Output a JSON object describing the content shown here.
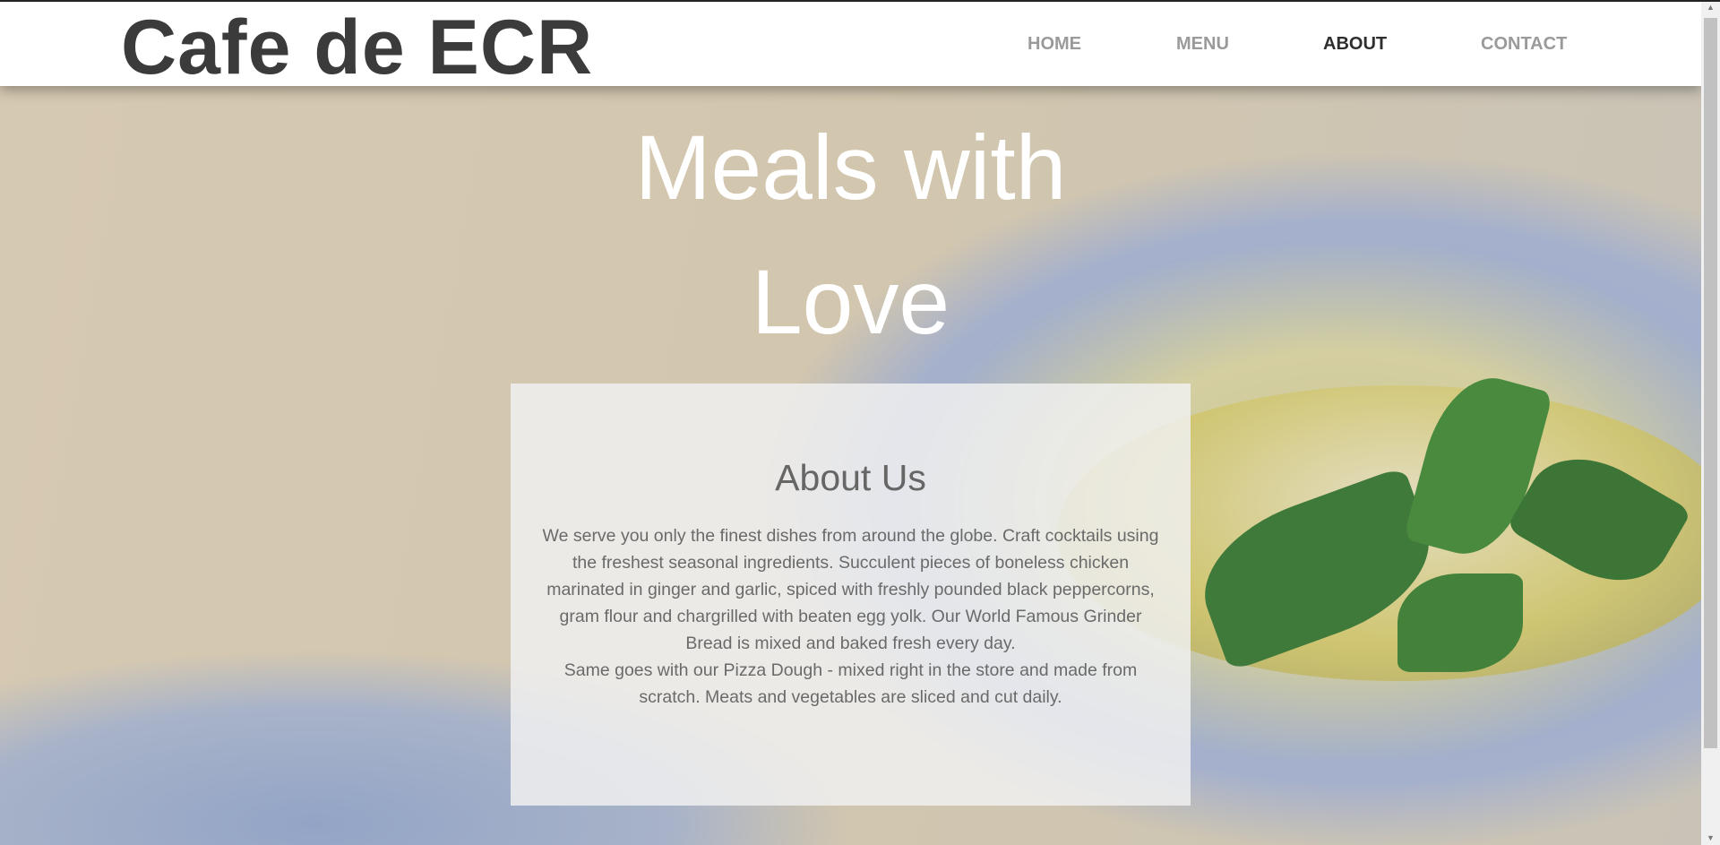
{
  "header": {
    "logo": "Cafe de ECR",
    "nav": [
      {
        "label": "HOME"
      },
      {
        "label": "MENU"
      },
      {
        "label": "ABOUT"
      },
      {
        "label": "CONTACT"
      }
    ]
  },
  "hero": {
    "title_line1": "Meals with",
    "title_line2": "Love"
  },
  "about": {
    "heading": "About Us",
    "paragraph1": "We serve you only the finest dishes from around the globe. Craft cocktails using the freshest seasonal ingredients. Succulent pieces of boneless chicken marinated in ginger and garlic, spiced with freshly pounded black peppercorns, gram flour and chargrilled with beaten egg yolk. Our World Famous Grinder Bread is mixed and baked fresh every day.",
    "paragraph2": "Same goes with our Pizza Dough - mixed right in the store and made from scratch. Meats and vegetables are sliced and cut daily."
  }
}
